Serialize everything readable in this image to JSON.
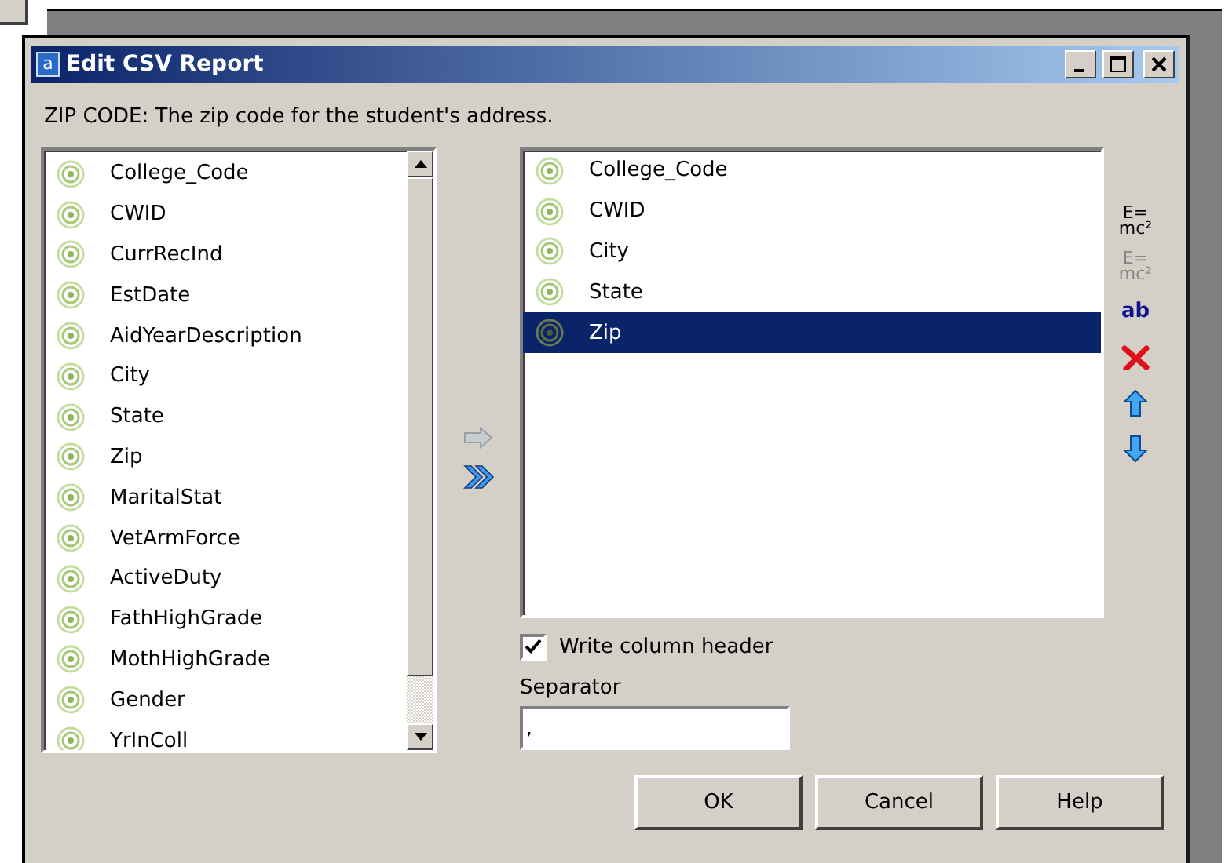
{
  "window": {
    "title": "Edit CSV Report",
    "app_icon": "a"
  },
  "description": "ZIP CODE: The zip code for the student's address.",
  "available_fields": [
    {
      "label": "College_Code"
    },
    {
      "label": "CWID"
    },
    {
      "label": "CurrRecInd"
    },
    {
      "label": "EstDate"
    },
    {
      "label": "AidYearDescription"
    },
    {
      "label": "City"
    },
    {
      "label": "State"
    },
    {
      "label": "Zip"
    },
    {
      "label": "MaritalStat"
    },
    {
      "label": "VetArmForce"
    },
    {
      "label": "ActiveDuty"
    },
    {
      "label": "FathHighGrade"
    },
    {
      "label": "MothHighGrade"
    },
    {
      "label": "Gender"
    },
    {
      "label": "YrInColl"
    }
  ],
  "move_buttons": [
    {
      "kind": "add",
      "disabled": true
    },
    {
      "kind": "add_all",
      "disabled": false
    }
  ],
  "selected_fields": [
    {
      "label": "College_Code",
      "selected": false
    },
    {
      "label": "CWID",
      "selected": false
    },
    {
      "label": "City",
      "selected": false
    },
    {
      "label": "State",
      "selected": false
    },
    {
      "label": "Zip",
      "selected": true
    }
  ],
  "tools": [
    {
      "kind": "formula",
      "glyph": "E=",
      "sub": "mc²",
      "disabled": false
    },
    {
      "kind": "formula",
      "glyph": "E=",
      "sub": "mc²",
      "disabled": true
    },
    {
      "kind": "rename",
      "glyph": "ab",
      "disabled": false
    },
    {
      "kind": "delete",
      "disabled": false
    },
    {
      "kind": "up",
      "disabled": false
    },
    {
      "kind": "down",
      "disabled": false
    }
  ],
  "write_column_header": {
    "label": "Write column header",
    "checked": true
  },
  "separator": {
    "label": "Separator",
    "value": ","
  },
  "buttons": [
    "OK",
    "Cancel",
    "Help"
  ]
}
